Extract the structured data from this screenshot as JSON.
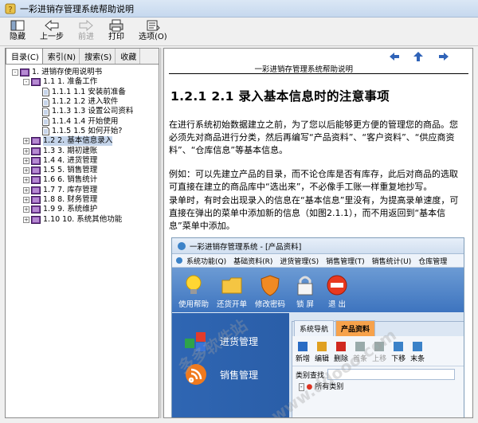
{
  "window": {
    "title": "一彩进销存管理系统帮助说明"
  },
  "toolbar": [
    {
      "label": "隐藏",
      "icon": "hide-icon",
      "enabled": true
    },
    {
      "label": "上一步",
      "icon": "back-arrow-icon",
      "enabled": true
    },
    {
      "label": "前进",
      "icon": "forward-arrow-icon",
      "enabled": false
    },
    {
      "label": "打印",
      "icon": "print-icon",
      "enabled": true
    },
    {
      "label": "选项(O)",
      "icon": "options-icon",
      "enabled": true
    }
  ],
  "tabs": [
    "目录(C)",
    "索引(N)",
    "搜索(S)",
    "收藏"
  ],
  "tree": [
    {
      "level": 0,
      "toggle": "-",
      "type": "book",
      "text": "1.  进销存使用说明书"
    },
    {
      "level": 1,
      "toggle": "-",
      "type": "book",
      "text": "1.1 1.  准备工作"
    },
    {
      "level": 2,
      "toggle": "",
      "type": "page",
      "text": "1.1.1 1.1  安装前准备"
    },
    {
      "level": 2,
      "toggle": "",
      "type": "page",
      "text": "1.1.2 1.2  进入软件"
    },
    {
      "level": 2,
      "toggle": "",
      "type": "page",
      "text": "1.1.3 1.3  设置公司资料"
    },
    {
      "level": 2,
      "toggle": "",
      "type": "page",
      "text": "1.1.4 1.4  开始使用"
    },
    {
      "level": 2,
      "toggle": "",
      "type": "page",
      "text": "1.1.5 1.5  如何开始?"
    },
    {
      "level": 1,
      "toggle": "+",
      "type": "book",
      "text": "1.2 2.  基本信息录入",
      "selected": true
    },
    {
      "level": 1,
      "toggle": "+",
      "type": "book",
      "text": "1.3 3.  期初建账"
    },
    {
      "level": 1,
      "toggle": "+",
      "type": "book",
      "text": "1.4 4.  进货管理"
    },
    {
      "level": 1,
      "toggle": "+",
      "type": "book",
      "text": "1.5 5.  销售管理"
    },
    {
      "level": 1,
      "toggle": "+",
      "type": "book",
      "text": "1.6 6.  销售统计"
    },
    {
      "level": 1,
      "toggle": "+",
      "type": "book",
      "text": "1.7 7.  库存管理"
    },
    {
      "level": 1,
      "toggle": "+",
      "type": "book",
      "text": "1.8 8.  财务管理"
    },
    {
      "level": 1,
      "toggle": "+",
      "type": "book",
      "text": "1.9 9.  系统维护"
    },
    {
      "level": 1,
      "toggle": "+",
      "type": "book",
      "text": "1.10 10.  系统其他功能"
    }
  ],
  "content": {
    "header": "一彩进销存管理系统帮助说明",
    "heading": "1.2.1 2.1 录入基本信息时的注意事项",
    "para1": "在进行系统初始数据建立之前，为了您以后能够更方便的管理您的商品。您必须先对商品进行分类，然后再编写“产品资料”、“客户资料”、“供应商资料”、“仓库信息”等基本信息。",
    "para2": "例如：可以先建立产品的目录，而不论仓库是否有库存，此后对商品的选取可直接在建立的商品库中“选出来”，不必像手工账一样重复地抄写。",
    "para3": "录单时，有时会出现录入的信息在“基本信息”里没有，为提高录单速度，可直接在弹出的菜单中添加新的信息（如图2.1.1），而不用返回到“基本信息”菜单中添加。"
  },
  "screenshot": {
    "title": "一彩进销存管理系统 - [产品资料]",
    "menu": [
      "系统功能(Q)",
      "基础资料(R)",
      "进货管理(S)",
      "销售管理(T)",
      "销售统计(U)",
      "仓库管理"
    ],
    "ribbon": [
      "使用帮助",
      "还货开单",
      "修改密码",
      "锁  屏",
      "退  出"
    ],
    "left_buttons": [
      "进货管理",
      "销售管理"
    ],
    "inner_tabs": [
      "系统导航",
      "产品资料"
    ],
    "inner_tools": [
      "新增",
      "编辑",
      "删除",
      "首条",
      "上移",
      "下移",
      "末条"
    ],
    "search_label": "类别查找",
    "tree_root": "所有类别"
  },
  "watermarks": [
    "多多软件站",
    "www.ddooo.com"
  ]
}
